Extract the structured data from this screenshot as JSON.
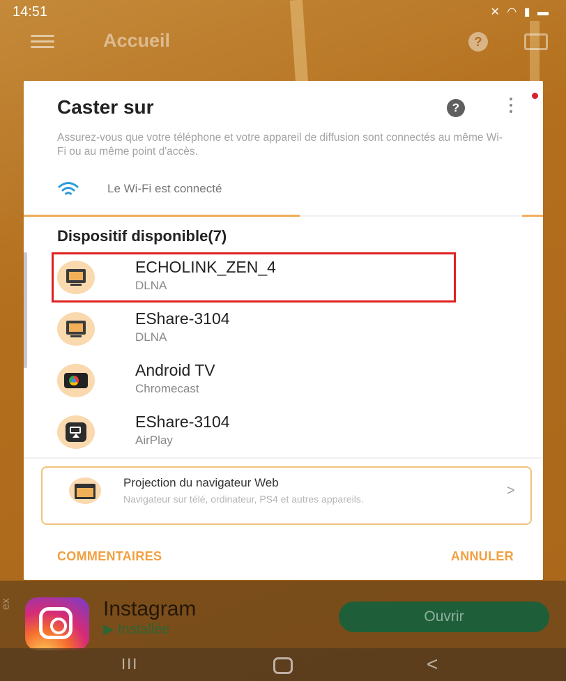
{
  "status_bar": {
    "time": "14:51",
    "icons": [
      "mute-icon",
      "wifi-icon",
      "signal-icon",
      "battery-icon"
    ]
  },
  "app_bar": {
    "title": "Accueil",
    "help_symbol": "?"
  },
  "dialog": {
    "title": "Caster sur",
    "help_symbol": "?",
    "description": "Assurez-vous que votre téléphone et votre appareil de diffusion sont connectés au même Wi-Fi ou au même point d'accès.",
    "wifi_status": "Le Wi-Fi est connecté",
    "section_title": "Dispositif disponible(7)",
    "devices": [
      {
        "name": "ECHOLINK_ZEN_4",
        "type": "DLNA",
        "icon": "monitor-icon",
        "selected": true
      },
      {
        "name": "EShare-3104",
        "type": "DLNA",
        "icon": "monitor-icon",
        "selected": false
      },
      {
        "name": "Android TV",
        "type": "Chromecast",
        "icon": "chromecast-icon",
        "selected": false
      },
      {
        "name": "EShare-3104",
        "type": "AirPlay",
        "icon": "airplay-icon",
        "selected": false
      }
    ],
    "browser_projection": {
      "title": "Projection du navigateur Web",
      "description": "Navigateur sur télé, ordinateur, PS4 et autres appareils.",
      "chevron": ">"
    },
    "feedback_label": "COMMENTAIRES",
    "cancel_label": "ANNULER",
    "colors": {
      "accent": "#f0a040",
      "selection_outline": "#e02020"
    }
  },
  "ad": {
    "side_tag": "ex",
    "app_name": "Instagram",
    "status": "Installée",
    "open_label": "Ouvrir"
  },
  "nav_bar": {
    "recents_symbol": "III",
    "back_symbol": "<"
  }
}
